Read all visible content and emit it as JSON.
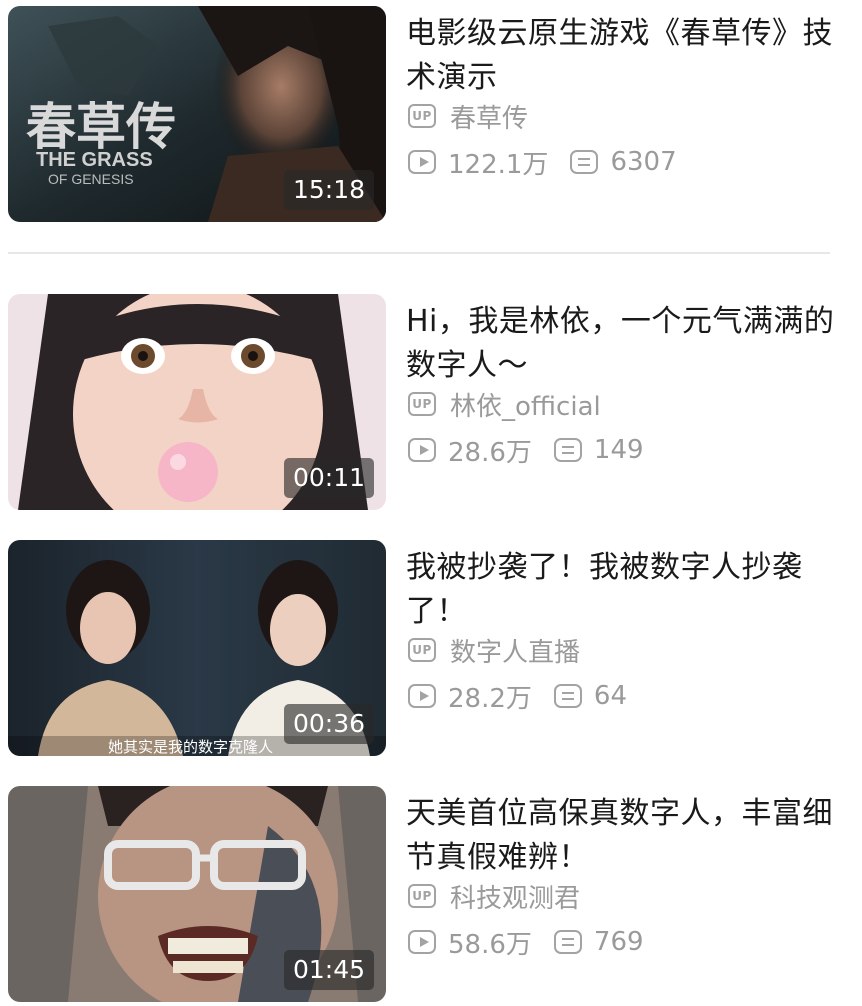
{
  "videos": [
    {
      "title": "电影级云原生游戏《春草传》技术演示",
      "author": "春草传",
      "views": "122.1万",
      "danmaku": "6307",
      "duration": "15:18",
      "thumb_text_cn": "春草传",
      "thumb_text_en1": "THE GRASS",
      "thumb_text_en2": "OF GENESIS"
    },
    {
      "title": "Hi，我是林依，一个元气满满的数字人～",
      "author": "林依_official",
      "views": "28.6万",
      "danmaku": "149",
      "duration": "00:11"
    },
    {
      "title": "我被抄袭了！我被数字人抄袭了！",
      "author": "数字人直播",
      "views": "28.2万",
      "danmaku": "64",
      "duration": "00:36",
      "thumb_caption": "她其实是我的数字克隆人"
    },
    {
      "title": "天美首位高保真数字人，丰富细节真假难辨！",
      "author": "科技观测君",
      "views": "58.6万",
      "danmaku": "769",
      "duration": "01:45"
    }
  ],
  "icons": {
    "author": "up-badge-icon",
    "views": "play-count-icon",
    "danmaku": "danmaku-icon"
  },
  "up_badge_label": "UP"
}
